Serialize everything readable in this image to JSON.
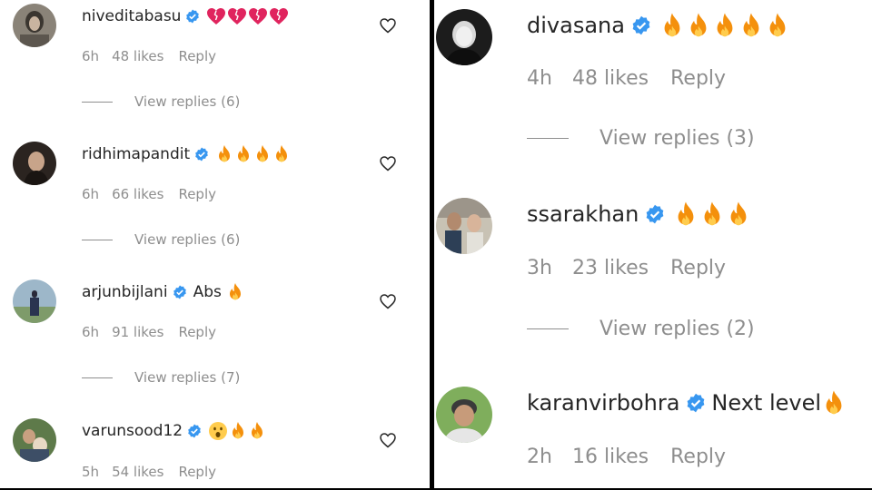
{
  "left": {
    "comments": [
      {
        "username": "niveditabasu",
        "text": "",
        "emojis": [
          "heart",
          "heart",
          "heart",
          "heart"
        ],
        "time": "6h",
        "likes": "48 likes",
        "reply": "Reply",
        "view_replies": "View replies (6)"
      },
      {
        "username": "ridhimapandit",
        "text": "",
        "emojis": [
          "fire",
          "fire",
          "fire",
          "fire"
        ],
        "time": "6h",
        "likes": "66 likes",
        "reply": "Reply",
        "view_replies": "View replies (6)"
      },
      {
        "username": "arjunbijlani",
        "text": "Abs",
        "emojis": [
          "fire"
        ],
        "time": "6h",
        "likes": "91 likes",
        "reply": "Reply",
        "view_replies": "View replies (7)"
      },
      {
        "username": "varunsood12",
        "text": "",
        "emojis": [
          "surprised",
          "fire",
          "fire"
        ],
        "time": "5h",
        "likes": "54 likes",
        "reply": "Reply",
        "view_replies": ""
      }
    ]
  },
  "right": {
    "comments": [
      {
        "username": "divasana",
        "text": "",
        "emojis": [
          "fire",
          "fire",
          "fire",
          "fire",
          "fire"
        ],
        "time": "4h",
        "likes": "48 likes",
        "reply": "Reply",
        "view_replies": "View replies (3)"
      },
      {
        "username": "ssarakhan",
        "text": "",
        "emojis": [
          "fire",
          "fire",
          "fire"
        ],
        "time": "3h",
        "likes": "23 likes",
        "reply": "Reply",
        "view_replies": "View replies (2)"
      },
      {
        "username": "karanvirbohra",
        "text": "Next level",
        "emojis": [
          "fire"
        ],
        "time": "2h",
        "likes": "16 likes",
        "reply": "Reply",
        "view_replies": ""
      }
    ]
  },
  "icons": {
    "verified": "verified-badge-icon",
    "like": "heart-outline-icon"
  },
  "colors": {
    "verified": "#3897f0",
    "meta": "#8e8e8e",
    "text": "#262626",
    "heart_emoji": "#e0245e",
    "fire_outer": "#f4900c",
    "fire_inner": "#ffcc4d"
  }
}
